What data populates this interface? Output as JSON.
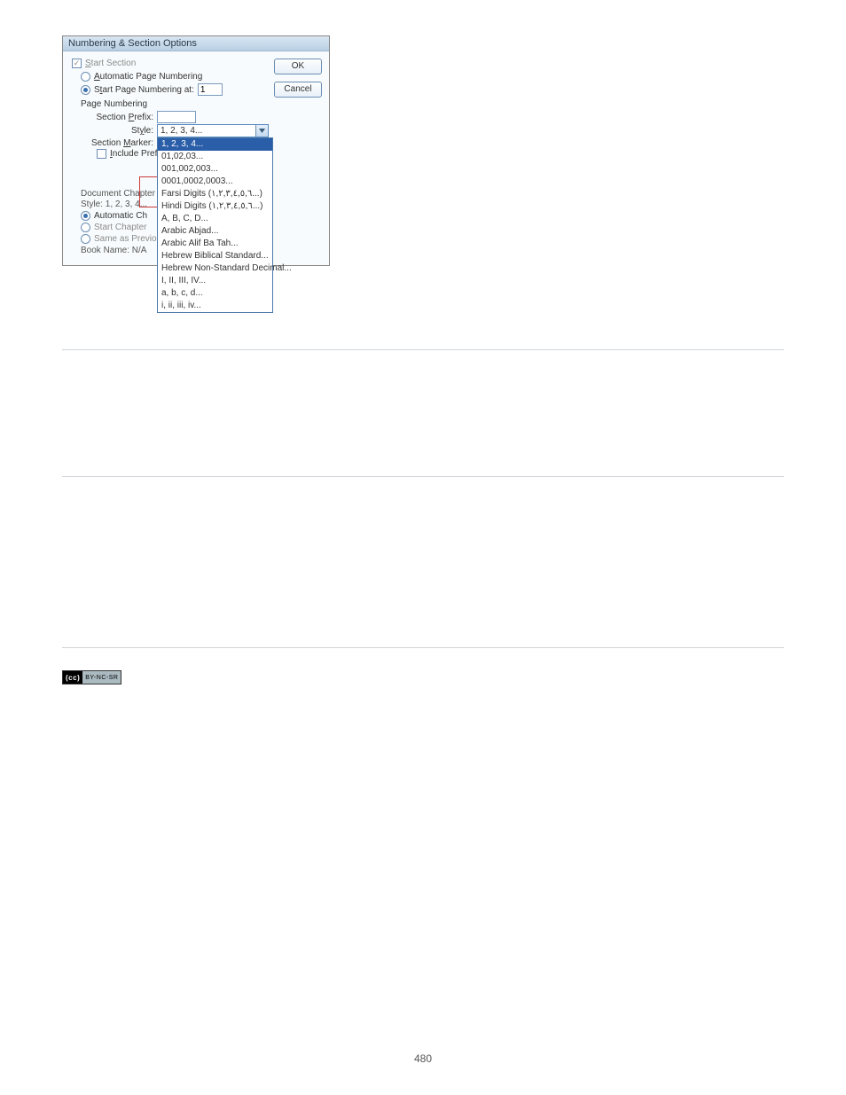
{
  "dialog": {
    "title": "Numbering & Section Options",
    "buttons": {
      "ok": "OK",
      "cancel": "Cancel"
    },
    "start_section": "Start Section",
    "auto_page_numbering": "Automatic Page Numbering",
    "start_page_numbering_at": "Start Page Numbering at:",
    "start_page_value": "1",
    "page_numbering_heading": "Page Numbering",
    "section_prefix_label": "Section Prefix:",
    "section_prefix_value": "",
    "style_label": "Style:",
    "style_selected": "1, 2, 3, 4...",
    "style_options": [
      "1, 2, 3, 4...",
      "01,02,03...",
      "001,002,003...",
      "0001,0002,0003...",
      "Farsi Digits (١,٢,٣,٤,٥,٦...)",
      "Hindi Digits (١,٢,٣,٤,٥,٦...)",
      "A, B, C, D...",
      "Arabic Abjad...",
      "Arabic Alif Ba Tah...",
      "Hebrew Biblical Standard...",
      "Hebrew Non-Standard Decimal...",
      "I, II, III, IV...",
      "a, b, c, d...",
      "i, ii, iii, iv..."
    ],
    "section_marker_label": "Section Marker:",
    "include_prefix": "Include Prefix",
    "document_chapter": "Document Chapter",
    "doc_style": "Style:  1, 2, 3, 4...",
    "automatic_ch": "Automatic Ch",
    "start_chapter": "Start Chapter",
    "same_as_prev": "Same as Previo",
    "book_name": "Book Name: N/A"
  },
  "cc": {
    "left": "(cc)",
    "right": "BY-NC-SR"
  },
  "page_number": "480"
}
